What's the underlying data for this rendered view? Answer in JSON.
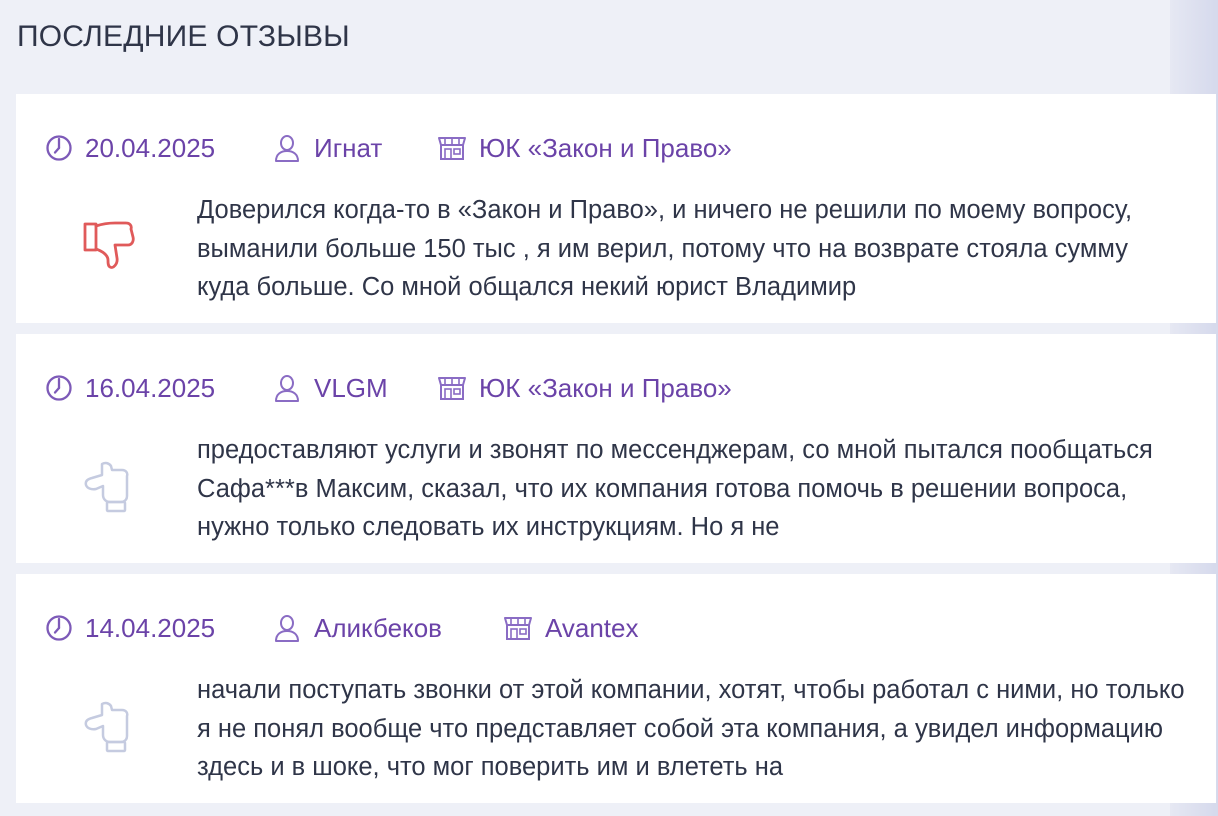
{
  "section": {
    "title": "ПОСЛЕДНИЕ ОТЗЫВЫ"
  },
  "colors": {
    "accent": "#6b43a8",
    "negative": "#e05a5a",
    "neutral": "#c5cbe0",
    "text": "#2f3548"
  },
  "reviews": [
    {
      "date": "20.04.2025",
      "author": "Игнат",
      "company": "ЮК «Закон и Право»",
      "rating": "negative",
      "rating_icon": "thumbs-down-icon",
      "text": "Доверился когда-то в «Закон и Право», и ничего не решили по моему вопросу, выманили больше 150 тыс , я им верил, потому что на возврате стояла сумму куда больше. Со мной общался некий юрист Владимир"
    },
    {
      "date": "16.04.2025",
      "author": "VLGM",
      "company": "ЮК «Закон и Право»",
      "rating": "neutral",
      "rating_icon": "neutral-hand-icon",
      "text": "предоставляют услуги и звонят по мессенджерам, со мной пытался пообщаться Сафа***в Максим, сказал, что их компания готова помочь в решении вопроса, нужно только следовать их инструкциям. Но я не"
    },
    {
      "date": "14.04.2025",
      "author": "Аликбеков",
      "company": "Avantex",
      "rating": "neutral",
      "rating_icon": "neutral-hand-icon",
      "text": "начали поступать звонки от этой компании, хотят, чтобы работал с ними, но только я не понял вообще что представляет собой эта компания, а увидел информацию здесь и в шоке, что мог поверить им и влететь на"
    }
  ]
}
